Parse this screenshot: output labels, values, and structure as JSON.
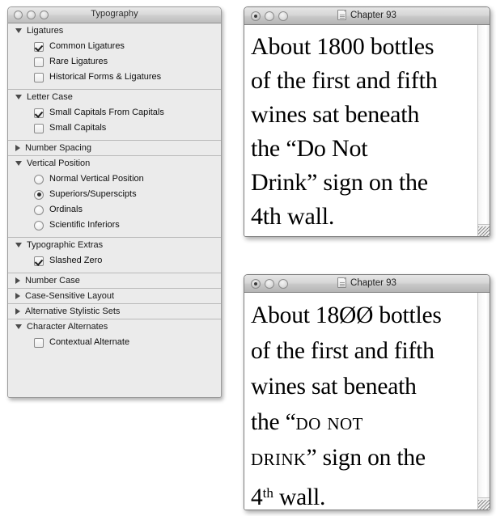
{
  "palette": {
    "title": "Typography",
    "window_controls": [
      "close",
      "minimize",
      "zoom"
    ],
    "sections": [
      {
        "name": "Ligatures",
        "expanded": true,
        "triangle": "down",
        "options": [
          {
            "type": "checkbox",
            "label": "Common Ligatures",
            "checked": true
          },
          {
            "type": "checkbox",
            "label": "Rare Ligatures",
            "checked": false
          },
          {
            "type": "checkbox",
            "label": "Historical Forms & Ligatures",
            "checked": false
          }
        ]
      },
      {
        "name": "Letter Case",
        "expanded": true,
        "triangle": "down",
        "options": [
          {
            "type": "checkbox",
            "label": "Small Capitals From Capitals",
            "checked": true
          },
          {
            "type": "checkbox",
            "label": "Small Capitals",
            "checked": false
          }
        ]
      },
      {
        "name": "Number Spacing",
        "expanded": false,
        "triangle": "right",
        "options": []
      },
      {
        "name": "Vertical Position",
        "expanded": true,
        "triangle": "down",
        "options": [
          {
            "type": "radio",
            "label": "Normal Vertical Position",
            "checked": false
          },
          {
            "type": "radio",
            "label": "Superiors/Superscipts",
            "checked": true
          },
          {
            "type": "radio",
            "label": "Ordinals",
            "checked": false
          },
          {
            "type": "radio",
            "label": "Scientific Inferiors",
            "checked": false
          }
        ]
      },
      {
        "name": "Typographic Extras",
        "expanded": true,
        "triangle": "down",
        "options": [
          {
            "type": "checkbox",
            "label": "Slashed Zero",
            "checked": true
          }
        ]
      },
      {
        "name": "Number Case",
        "expanded": false,
        "triangle": "right",
        "options": []
      },
      {
        "name": "Case-Sensitive Layout",
        "expanded": false,
        "triangle": "right",
        "options": []
      },
      {
        "name": "Alternative Stylistic Sets",
        "expanded": false,
        "triangle": "right",
        "options": []
      },
      {
        "name": "Character Alternates",
        "expanded": true,
        "triangle": "down",
        "options": [
          {
            "type": "checkbox",
            "label": "Contextual Alternate",
            "checked": false
          }
        ]
      }
    ]
  },
  "documents": [
    {
      "id": "doc-top",
      "title": "Chapter 93",
      "icon": "document-icon",
      "lines": [
        {
          "segments": [
            {
              "text": "About 1800 bottles",
              "style": "plain"
            }
          ]
        },
        {
          "segments": [
            {
              "text": "of the first and fifth",
              "style": "plain"
            }
          ]
        },
        {
          "segments": [
            {
              "text": "wines sat beneath",
              "style": "plain"
            }
          ]
        },
        {
          "segments": [
            {
              "text": "the “Do Not",
              "style": "plain"
            }
          ]
        },
        {
          "segments": [
            {
              "text": "Drink” sign on the",
              "style": "plain"
            }
          ]
        },
        {
          "segments": [
            {
              "text": "4th wall.",
              "style": "plain"
            }
          ]
        }
      ]
    },
    {
      "id": "doc-bottom",
      "title": "Chapter 93",
      "icon": "document-icon",
      "lines": [
        {
          "segments": [
            {
              "text": "About 18ØØ bottles",
              "style": "plain"
            }
          ]
        },
        {
          "segments": [
            {
              "text": "of the first and fifth",
              "style": "plain"
            }
          ]
        },
        {
          "segments": [
            {
              "text": "wines sat beneath",
              "style": "plain"
            }
          ]
        },
        {
          "segments": [
            {
              "text": "the “",
              "style": "plain"
            },
            {
              "text": "Do Not",
              "style": "smallcaps"
            }
          ]
        },
        {
          "segments": [
            {
              "text": "Drink",
              "style": "smallcaps"
            },
            {
              "text": "” sign on the",
              "style": "plain"
            }
          ]
        },
        {
          "segments": [
            {
              "text": "4",
              "style": "plain"
            },
            {
              "text": "th",
              "style": "superscript"
            },
            {
              "text": " wall.",
              "style": "plain"
            }
          ]
        }
      ]
    }
  ]
}
